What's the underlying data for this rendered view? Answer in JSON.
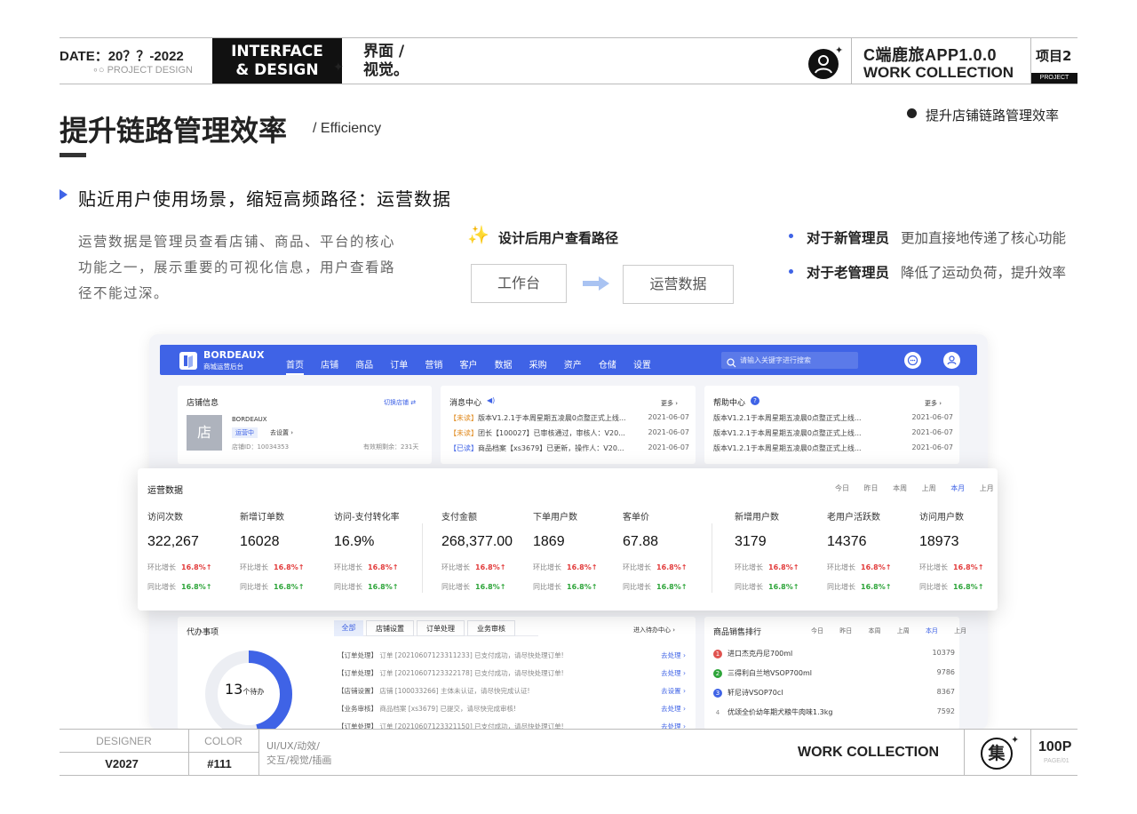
{
  "header": {
    "date": "DATE：20？？-2022",
    "project_design": "∘○ PROJECT DESIGN",
    "interface_line1": "INTERFACE",
    "interface_line2": "& DESIGN",
    "cn_line1": "界面 /",
    "cn_line2": "视觉。",
    "app_title": "C端鹿旅APP1.0.0",
    "work_collection": "WORK  COLLECTION",
    "project_no": "项目2",
    "project_tag": "PROJECT"
  },
  "title": {
    "main": "提升链路管理效率",
    "sub": "/ Efficiency",
    "side": "提升店铺链路管理效率"
  },
  "section": {
    "heading": "贴近用户使用场景，缩短高频路径：运营数据",
    "desc": "运营数据是管理员查看店铺、商品、平台的核心功能之一，展示重要的可视化信息，用户查看路径不能过深。",
    "path_title": "设计后用户查看路径",
    "path_from": "工作台",
    "path_to": "运营数据",
    "bullets": [
      {
        "k": "对于新管理员",
        "v": "更加直接地传递了核心功能"
      },
      {
        "k": "对于老管理员",
        "v": "降低了运动负荷，提升效率"
      }
    ]
  },
  "dashboard": {
    "brand": "BORDEAUX",
    "brand_sub": "商城运营后台",
    "nav": [
      "首页",
      "店铺",
      "商品",
      "订单",
      "营销",
      "客户",
      "数据",
      "采购",
      "资产",
      "仓储",
      "设置"
    ],
    "search_placeholder": "请输入关键字进行搜索",
    "store": {
      "title": "店铺信息",
      "switch": "切换店铺 ⇄",
      "avatar": "店",
      "name": "BORDEAUX",
      "status": "运营中",
      "setting": "去设置 ›",
      "id": "店铺ID：10034353",
      "expire": "有效期剩余：231天"
    },
    "messages": {
      "title": "消息中心",
      "more": "更多 ›",
      "rows": [
        {
          "tag": "【未读】",
          "text": "版本V1.2.1于本周星期五凌晨0点整正式上线...",
          "date": "2021-06-07"
        },
        {
          "tag": "【未读】",
          "text": "团长【100027】已审核通过，审核人：V20...",
          "date": "2021-06-07"
        },
        {
          "tag": "【已读】",
          "text": "商品档案【xs3679】已更新，操作人：V20...",
          "date": "2021-06-07"
        }
      ]
    },
    "help": {
      "title": "帮助中心",
      "more": "更多 ›",
      "rows": [
        {
          "text": "版本V1.2.1于本周星期五凌晨0点整正式上线...",
          "date": "2021-06-07"
        },
        {
          "text": "版本V1.2.1于本周星期五凌晨0点整正式上线...",
          "date": "2021-06-07"
        },
        {
          "text": "版本V1.2.1于本周星期五凌晨0点整正式上线...",
          "date": "2021-06-07"
        }
      ]
    },
    "ops": {
      "title": "运营数据",
      "periods": [
        "今日",
        "昨日",
        "本周",
        "上周",
        "本月",
        "上月"
      ],
      "active_period": "本月",
      "mom_label": "环比增长",
      "yoy_label": "同比增长",
      "metrics": [
        {
          "label": "访问次数",
          "value": "322,267",
          "mom": "16.8%↑",
          "yoy": "16.8%↑"
        },
        {
          "label": "新增订单数",
          "value": "16028",
          "mom": "16.8%↑",
          "yoy": "16.8%↑"
        },
        {
          "label": "访问-支付转化率",
          "value": "16.9%",
          "mom": "16.8%↑",
          "yoy": "16.8%↑"
        },
        {
          "label": "支付金额",
          "value": "268,377.00",
          "mom": "16.8%↑",
          "yoy": "16.8%↑"
        },
        {
          "label": "下单用户数",
          "value": "1869",
          "mom": "16.8%↑",
          "yoy": "16.8%↑"
        },
        {
          "label": "客单价",
          "value": "67.88",
          "mom": "16.8%↑",
          "yoy": "16.8%↑"
        },
        {
          "label": "新增用户数",
          "value": "3179",
          "mom": "16.8%↑",
          "yoy": "16.8%↑"
        },
        {
          "label": "老用户活跃数",
          "value": "14376",
          "mom": "16.8%↑",
          "yoy": "16.8%↑"
        },
        {
          "label": "访问用户数",
          "value": "18973",
          "mom": "16.8%↑",
          "yoy": "16.8%↑"
        }
      ]
    },
    "todo": {
      "title": "代办事项",
      "count": "13",
      "count_unit": "个待办",
      "tabs": [
        "全部",
        "店铺设置",
        "订单处理",
        "业务审核"
      ],
      "enter": "进入待办中心 ›",
      "rows": [
        {
          "tag": "【订单处理】",
          "text": "订单 [20210607123311233] 已支付成功，请尽快处理订单!",
          "act": "去处理 ›"
        },
        {
          "tag": "【订单处理】",
          "text": "订单 [20210607123322178] 已支付成功，请尽快处理订单!",
          "act": "去处理 ›"
        },
        {
          "tag": "【店铺设置】",
          "text": "店铺 [100033266] 主体未认证，请尽快完成认证!",
          "act": "去设置 ›"
        },
        {
          "tag": "【业务审核】",
          "text": "商品档案 [xs3679] 已提交，请尽快完成审核!",
          "act": "去处理 ›"
        },
        {
          "tag": "【订单处理】",
          "text": "订单 [20210607123321150] 已支付成功，请尽快处理订单!",
          "act": "去处理 ›"
        }
      ]
    },
    "ranking": {
      "title": "商品销售排行",
      "periods": [
        "今日",
        "昨日",
        "本周",
        "上周",
        "本月",
        "上月"
      ],
      "active_period": "本月",
      "rows": [
        {
          "rank": "1",
          "name": "进口杰克丹尼700ml",
          "value": "10379",
          "color": "#e0524f"
        },
        {
          "rank": "2",
          "name": "三得利白兰地VSOP700ml",
          "value": "9786",
          "color": "#2ea53a"
        },
        {
          "rank": "3",
          "name": "轩尼诗VSOP70cl",
          "value": "8367",
          "color": "#3f63e6"
        },
        {
          "rank": "4",
          "name": "优颂全价幼年期犬粮牛肉味1.3kg",
          "value": "7592",
          "color": ""
        }
      ]
    }
  },
  "footer": {
    "designer_label": "DESIGNER",
    "designer": "V2027",
    "color_label": "COLOR",
    "color": "#111",
    "tags_line1": "UI/UX/动效/",
    "tags_line2": "交互/视觉/插画",
    "work_collection": "WORK  COLLECTION",
    "ji": "集",
    "page": "100P",
    "page_sub": "PAGE/01"
  },
  "colors": {
    "accent": "#3f63e6",
    "up_red": "#e23b3b",
    "up_green": "#2ea53a",
    "dark": "#111111"
  }
}
